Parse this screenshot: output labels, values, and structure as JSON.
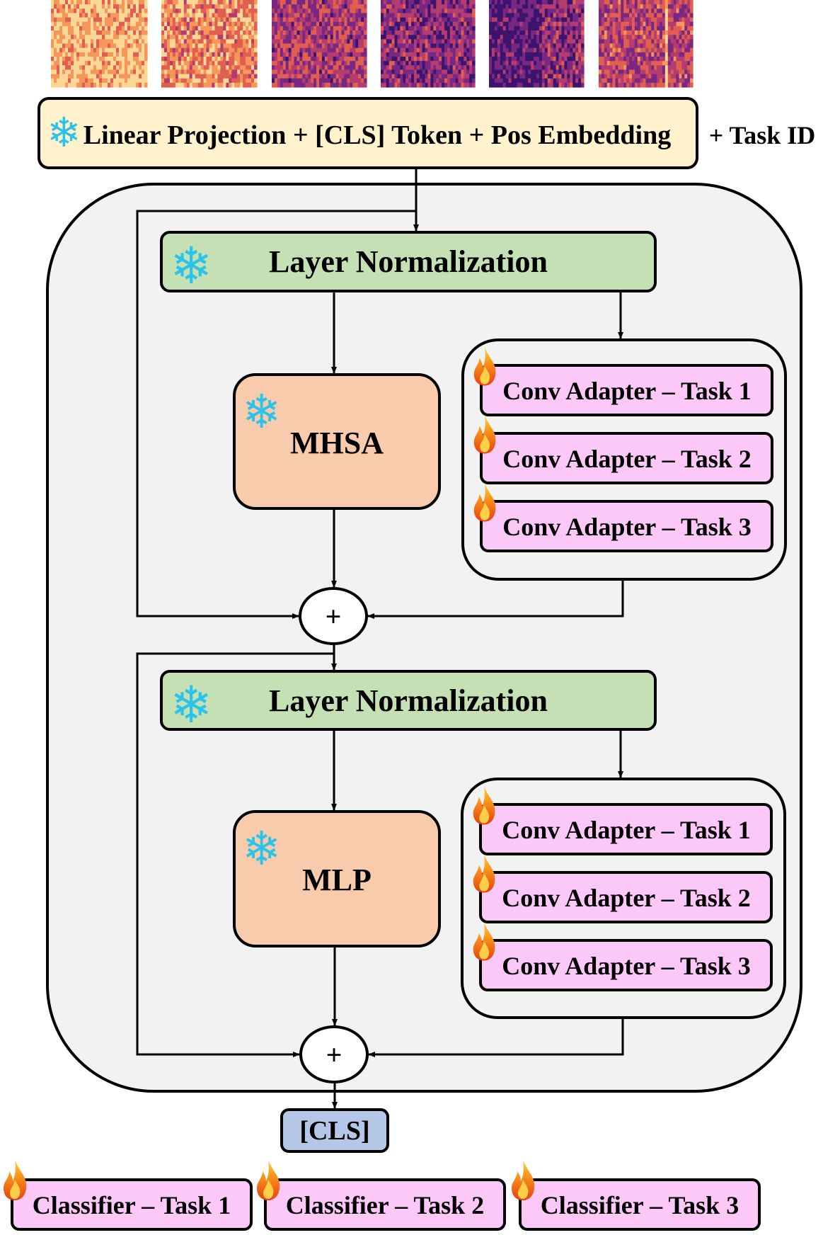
{
  "input": {
    "label": "Linear Projection + [CLS] Token + Pos Embedding",
    "extra": "+ Task ID"
  },
  "block1": {
    "norm": "Layer Normalization",
    "core": "MHSA",
    "adapters": [
      "Conv Adapter – Task 1",
      "Conv Adapter – Task 2",
      "Conv Adapter – Task 3"
    ],
    "sum": "+"
  },
  "block2": {
    "norm": "Layer Normalization",
    "core": "MLP",
    "adapters": [
      "Conv Adapter – Task 1",
      "Conv Adapter – Task 2",
      "Conv Adapter – Task 3"
    ],
    "sum": "+"
  },
  "output": {
    "cls": "[CLS]"
  },
  "classifiers": [
    "Classifier – Task 1",
    "Classifier – Task 2",
    "Classifier – Task 3"
  ],
  "icons": {
    "frozen": "snowflake-icon",
    "trainable": "flame-icon"
  },
  "colors": {
    "input": "#fff2cc",
    "norm": "#c5e0b4",
    "core": "#f8cbad",
    "adapter": "#fbc8f8",
    "cls": "#b4c7e7",
    "block": "#f2f2f2",
    "frozen": "#2cc3e8"
  }
}
